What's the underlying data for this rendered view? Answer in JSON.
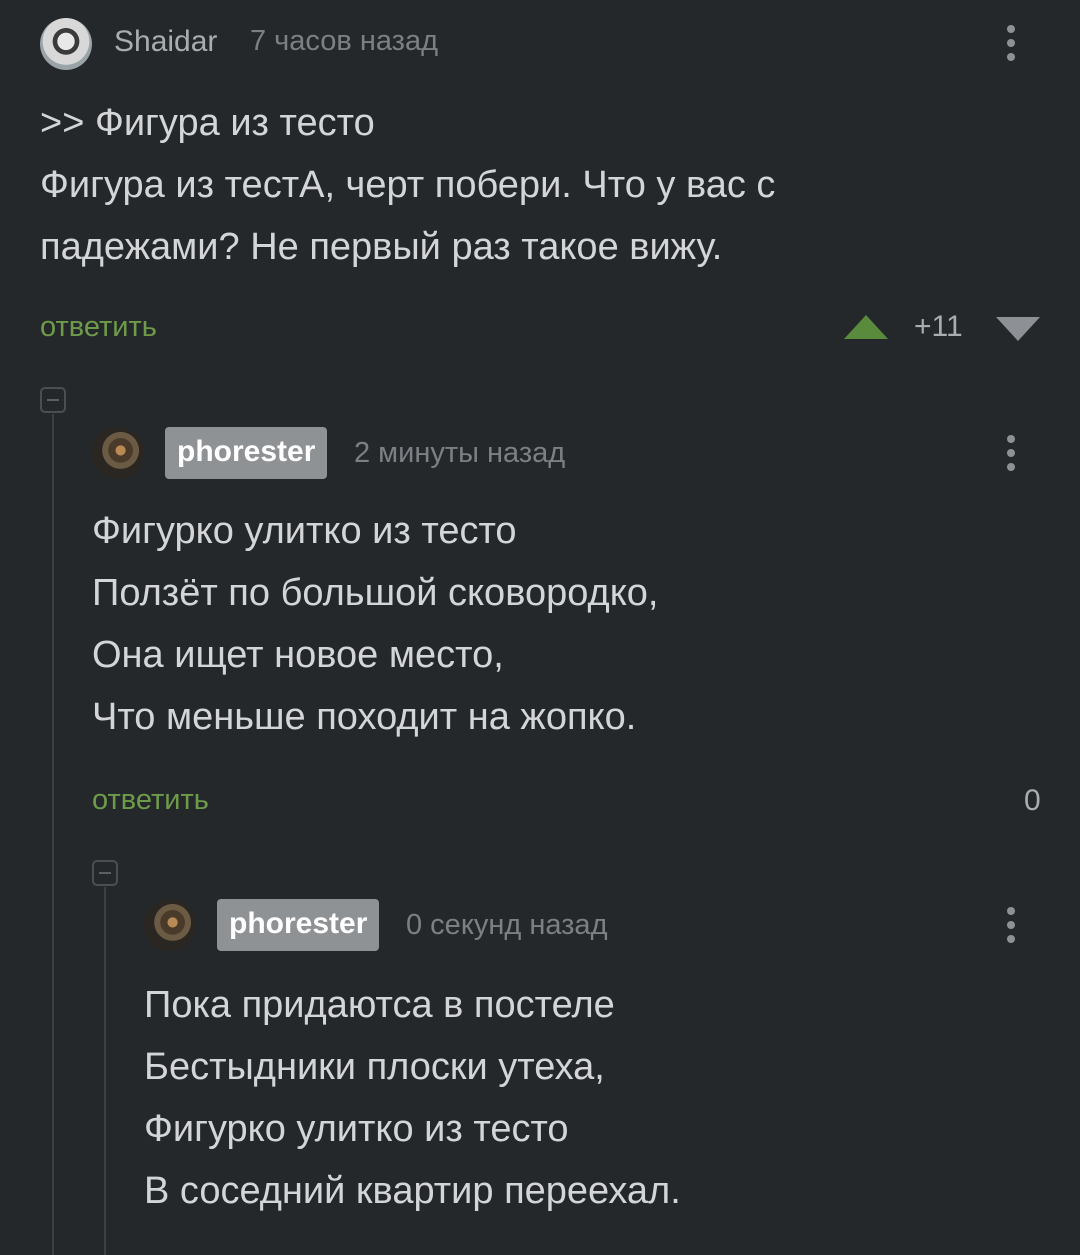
{
  "comments": [
    {
      "author": "Shaidar",
      "time": "7 часов назад",
      "text": ">> Фигура из тесто\nФигура из тестА, черт побери. Что у вас с\nпадежами? Не первый раз такое вижу.",
      "reply_label": "ответить",
      "rating": "+11"
    },
    {
      "author": "phorester",
      "time": "2 минуты назад",
      "text": "Фигурко улитко из тесто\nПолзёт по большой сковородко,\nОна ищет новое место,\nЧто меньше походит на жопко.",
      "reply_label": "ответить",
      "rating": "0"
    },
    {
      "author": "phorester",
      "time": "0 секунд назад",
      "text": "Пока придаютса в постеле\nБестыдники плоски утеха,\nФигурко улитко из тесто\nВ соседний квартир переехал."
    }
  ],
  "colors": {
    "background": "#25282b",
    "reply_link": "#6e9b4a",
    "upvote_arrow": "#5a8a3c",
    "downvote_arrow": "#8d9195",
    "author_badge": "#8f9295"
  },
  "icons": [
    "more-options-icon",
    "upvote-icon",
    "downvote-icon",
    "collapse-thread-icon"
  ]
}
